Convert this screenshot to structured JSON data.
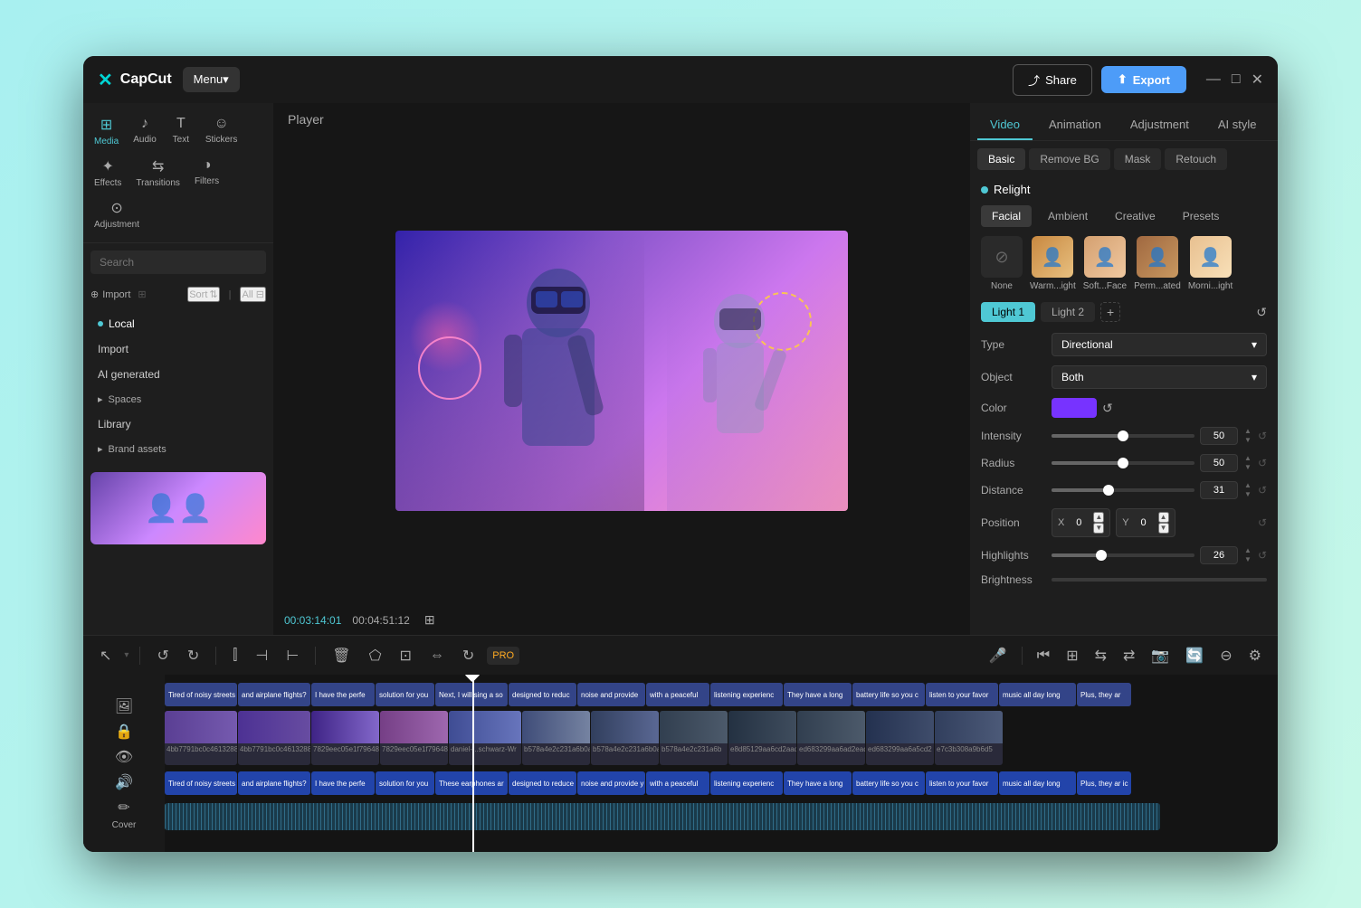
{
  "app": {
    "name": "CapCut",
    "logo_icon": "✕"
  },
  "title_bar": {
    "menu_label": "Menu▾",
    "share_label": "Share",
    "export_label": "Export",
    "window_minimize": "—",
    "window_maximize": "□",
    "window_close": "✕"
  },
  "left_panel": {
    "tools": [
      {
        "id": "media",
        "icon": "⊞",
        "label": "Media",
        "active": true
      },
      {
        "id": "audio",
        "icon": "♪",
        "label": "Audio",
        "active": false
      },
      {
        "id": "text",
        "icon": "T",
        "label": "Text",
        "active": false
      },
      {
        "id": "stickers",
        "icon": "☺",
        "label": "Stickers",
        "active": false
      },
      {
        "id": "effects",
        "icon": "✦",
        "label": "Effects",
        "active": false
      },
      {
        "id": "transitions",
        "icon": "⇆",
        "label": "Transitions",
        "active": false
      },
      {
        "id": "filters",
        "icon": "◑",
        "label": "Filters",
        "active": false
      },
      {
        "id": "adjustment",
        "icon": "⊙",
        "label": "Adjustment",
        "active": false
      }
    ],
    "import_label": "Import",
    "sort_label": "Sort",
    "all_label": "All",
    "nav_items": [
      {
        "label": "Local",
        "active": true,
        "has_dot": true
      },
      {
        "label": "Import",
        "active": false
      },
      {
        "label": "AI generated",
        "active": false
      },
      {
        "label": "Spaces",
        "active": false,
        "is_group": true
      },
      {
        "label": "Library",
        "active": false
      },
      {
        "label": "Brand assets",
        "active": false,
        "is_group": true
      }
    ]
  },
  "player": {
    "title": "Player",
    "time_current": "00:03:14:01",
    "time_total": "00:04:51:12"
  },
  "right_panel": {
    "tabs": [
      {
        "label": "Video",
        "active": true
      },
      {
        "label": "Animation",
        "active": false
      },
      {
        "label": "Adjustment",
        "active": false
      },
      {
        "label": "AI style",
        "active": false
      }
    ],
    "sub_tabs": [
      {
        "label": "Basic",
        "active": true
      },
      {
        "label": "Remove BG",
        "active": false
      },
      {
        "label": "Mask",
        "active": false
      },
      {
        "label": "Retouch",
        "active": false
      }
    ],
    "relight": {
      "label": "Relight",
      "mode_tabs": [
        {
          "label": "Facial",
          "active": true
        },
        {
          "label": "Ambient",
          "active": false
        },
        {
          "label": "Creative",
          "active": false
        },
        {
          "label": "Presets",
          "active": false
        }
      ],
      "presets": [
        {
          "label": "None",
          "type": "none"
        },
        {
          "label": "Warm...ight",
          "type": "warm"
        },
        {
          "label": "Soft...Face",
          "type": "soft"
        },
        {
          "label": "Perm...ated",
          "type": "perm"
        },
        {
          "label": "Morni...ight",
          "type": "morn"
        }
      ],
      "light_tabs": [
        {
          "label": "Light 1",
          "active": true
        },
        {
          "label": "Light 2",
          "active": false
        }
      ],
      "controls": {
        "type_label": "Type",
        "type_value": "Directional",
        "object_label": "Object",
        "object_value": "Both",
        "color_label": "Color",
        "intensity_label": "Intensity",
        "intensity_value": "50",
        "intensity_percent": 50,
        "radius_label": "Radius",
        "radius_value": "50",
        "radius_percent": 50,
        "distance_label": "Distance",
        "distance_value": "31",
        "distance_percent": 40,
        "position_label": "Position",
        "position_x": "0",
        "position_y": "0",
        "highlights_label": "Highlights",
        "highlights_value": "26",
        "highlights_percent": 35,
        "brightness_label": "Brightness"
      }
    }
  },
  "timeline": {
    "toolbar_buttons": [
      "cursor",
      "undo",
      "redo",
      "split",
      "split-left",
      "split-right",
      "delete",
      "shape",
      "crop",
      "flip",
      "rotate",
      "pro"
    ],
    "right_buttons": [
      "prev-frame",
      "add-clip",
      "transition",
      "move",
      "camera",
      "loop",
      "minus",
      "settings"
    ],
    "cover_label": "Cover",
    "tracks": [
      {
        "type": "text",
        "clips": [
          "Tired of noisy streets",
          "and airplane flights?",
          "I have the perfe",
          "solution for you",
          "Next, I will sing a so",
          "designed to reduc",
          "noise and provide",
          "with a peaceful",
          "listening experienc",
          "They have a long",
          "battery life so you c",
          "listen to your favor",
          "music all day long",
          "Plus, they ar"
        ]
      },
      {
        "type": "main"
      },
      {
        "type": "audio"
      }
    ]
  }
}
